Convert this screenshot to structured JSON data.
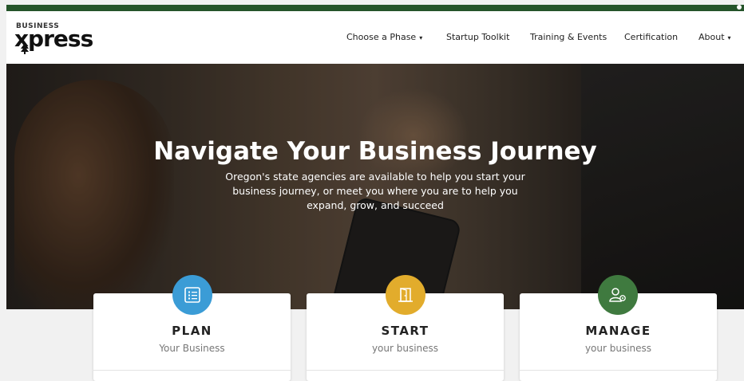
{
  "brand": {
    "logo_small": "BUSINESS",
    "logo_big": "xpress",
    "colors": {
      "topbar": "#25542a",
      "plan": "#3b9cd6",
      "start": "#e2ac2c",
      "manage": "#3f7a3f"
    }
  },
  "nav": {
    "items": [
      {
        "label": "Choose a Phase",
        "has_dropdown": true
      },
      {
        "label": "Startup Toolkit",
        "has_dropdown": false
      },
      {
        "label": "Training & Events",
        "has_dropdown": false
      },
      {
        "label": "Certification",
        "has_dropdown": false
      },
      {
        "label": "About",
        "has_dropdown": true
      }
    ]
  },
  "hero": {
    "title": "Navigate Your Business Journey",
    "subtitle": "Oregon's state agencies are available to help you start your business journey, or meet you where you are to help you expand, grow, and succeed"
  },
  "cards": [
    {
      "title": "PLAN",
      "subtitle": "Your Business",
      "icon": "list-icon"
    },
    {
      "title": "START",
      "subtitle": "your business",
      "icon": "door-icon"
    },
    {
      "title": "MANAGE",
      "subtitle": "your business",
      "icon": "user-gear-icon"
    }
  ]
}
